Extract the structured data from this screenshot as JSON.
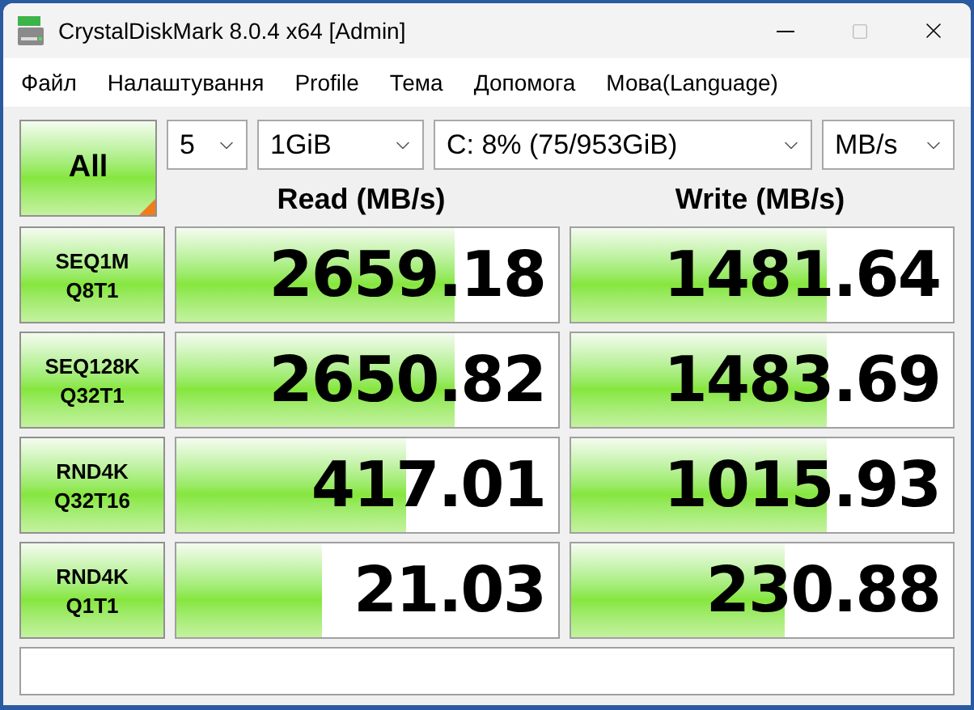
{
  "window": {
    "title": "CrystalDiskMark 8.0.4 x64 [Admin]"
  },
  "menu": [
    "Файл",
    "Налаштування",
    "Profile",
    "Тема",
    "Допомога",
    "Мова(Language)"
  ],
  "all_button": "All",
  "selectors": [
    {
      "value": "5"
    },
    {
      "value": "1GiB"
    },
    {
      "value": "C: 8% (75/953GiB)"
    },
    {
      "value": "MB/s"
    }
  ],
  "headers": [
    "Read (MB/s)",
    "Write (MB/s)"
  ],
  "tests": [
    {
      "name": "SEQ1M",
      "params": "Q8T1",
      "read": {
        "reading": "2659.18",
        "level": 0.73
      },
      "write": {
        "reading": "1481.64",
        "level": 0.67
      }
    },
    {
      "name": "SEQ128K",
      "params": "Q32T1",
      "read": {
        "reading": "2650.82",
        "level": 0.73
      },
      "write": {
        "reading": "1483.69",
        "level": 0.67
      }
    },
    {
      "name": "RND4K",
      "params": "Q32T16",
      "read": {
        "reading": "417.01",
        "level": 0.6
      },
      "write": {
        "reading": "1015.93",
        "level": 0.67
      }
    },
    {
      "name": "RND4K",
      "params": "Q1T1",
      "read": {
        "reading": "21.03",
        "level": 0.38
      },
      "write": {
        "reading": "230.88",
        "level": 0.56
      }
    }
  ]
}
